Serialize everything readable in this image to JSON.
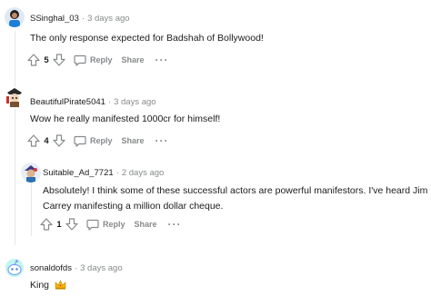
{
  "comments": [
    {
      "author": "SSinghal_03",
      "time": "3 days ago",
      "body": "The only response expected for Badshah of Bollywood!",
      "score": "5",
      "reply_label": "Reply",
      "share_label": "Share",
      "more_label": "···"
    },
    {
      "author": "BeautifulPirate5041",
      "time": "3 days ago",
      "body": "Wow he really manifested 1000cr for himself!",
      "score": "4",
      "reply_label": "Reply",
      "share_label": "Share",
      "more_label": "···"
    },
    {
      "author": "Suitable_Ad_7721",
      "time": "2 days ago",
      "body_line1": "Absolutely! I think some of these successful actors are powerful manifestors. I've heard Jim",
      "body_line2": "Carrey manifesting a million dollar cheque.",
      "score": "1",
      "reply_label": "Reply",
      "share_label": "Share",
      "more_label": "···"
    },
    {
      "author": "sonaldofds",
      "time": "3 days ago",
      "body": "King",
      "emoji": "crown-emoji"
    }
  ],
  "separator": "·",
  "colors": {
    "muted": "#878a8c",
    "text": "#1c1c1c",
    "thread_line": "#e4e6e8",
    "crown": "#f5b400"
  }
}
